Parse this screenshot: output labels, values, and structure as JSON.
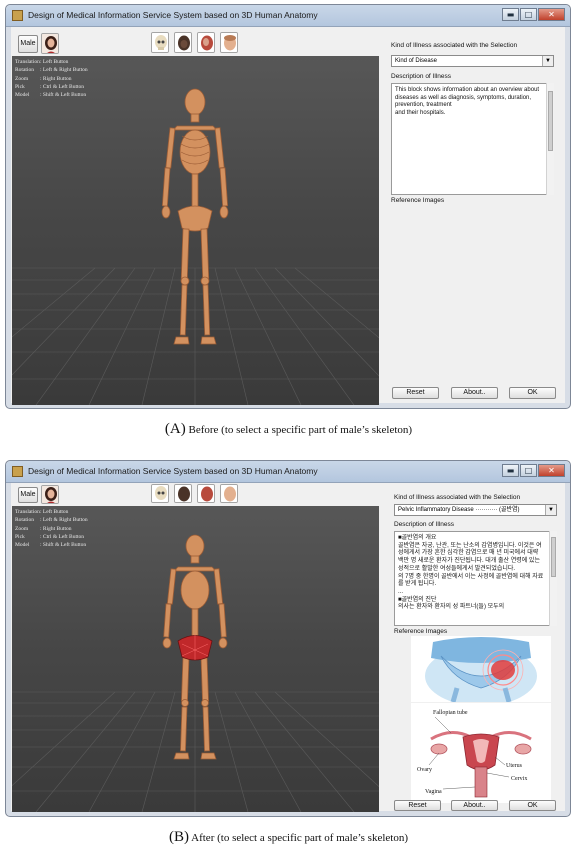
{
  "window": {
    "title": "Design of Medical Information Service System based on 3D Human Anatomy",
    "minimize_glyph": "▬",
    "maximize_glyph": "□",
    "close_glyph": "✕"
  },
  "toolbar": {
    "male_label": "Male"
  },
  "controls": [
    {
      "key": "Translation",
      "value": ": Left Button"
    },
    {
      "key": "Rotation",
      "value": ": Left & Right Button"
    },
    {
      "key": "Zoom",
      "value": ": Right Button"
    },
    {
      "key": "Pick",
      "value": ": Ctrl & Left Button"
    },
    {
      "key": "Model",
      "value": ": Shift & Left Button"
    }
  ],
  "labels": {
    "kind": "Kind of Illness associated with the Selection",
    "description": "Description of Illness",
    "reference": "Reference Images"
  },
  "buttons": {
    "reset": "Reset",
    "about": "About..",
    "ok": "OK"
  },
  "before": {
    "kind_value": "Kind of Disease",
    "description": "This block shows information about an overview about diseases as well as diagnosis, symptoms, duration, prevention, treatment\nand their hospitals.",
    "caption_letter": "(A)",
    "caption_text": " Before (to select a specific part of male’s skeleton)"
  },
  "after": {
    "kind_value": "Pelvic Inflammatory Disease ··········· (골반염)",
    "description": "■골반염의 개요\n골반염은 자궁, 난관, 또는 난소의 감염병입니다. 이것은 여성에게서 가장 흔한 심각한 감염으로 매 년 미국에서 대략 백만 명 새로운 환자가 진단됩니다. 대개 출산 연령에 있는 성적으로 활발한 여성들에게서 발견되었습니다.\n의 7명 중 한명이 골반에서 이는 사정에 골반염에 대해 자료를 받게 됩니다.\n...\n■골반염의 진단\n의사는 환자와 환자의 성 파트너(들) 모두의",
    "ref_labels": [
      "Fallopian tube",
      "Ovary",
      "Uterus",
      "Cervix",
      "Vagina"
    ],
    "caption_letter": "(B)",
    "caption_text": " After (to select a specific part of male’s skeleton)"
  },
  "colors": {
    "bone": "#d3915f",
    "bone_dark": "#9c5d36",
    "selected": "#c0282a"
  }
}
